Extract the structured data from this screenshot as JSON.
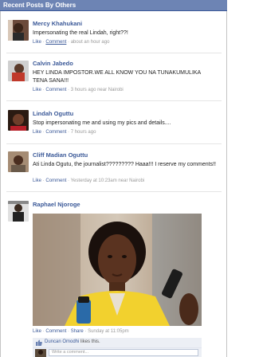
{
  "panel": {
    "title": "Recent Posts By Others"
  },
  "posts": [
    {
      "name": "Mercy Khahukani",
      "text": "Impersonating the real Lindah, right??!",
      "meta_like": "Like",
      "meta_comment": "Comment",
      "meta_time": "about an hour ago"
    },
    {
      "name": "Calvin Jabedo",
      "text": "HEY LINDA IMPOSTOR.WE ALL KNOW YOU NA TUNAKUMULIKA TENA SANA!!!",
      "meta_like": "Like",
      "meta_comment": "Comment",
      "meta_time": "3 hours ago near Nairobi"
    },
    {
      "name": "Lindah Oguttu",
      "text": "Stop impersonating me and using my pics and details....",
      "meta_like": "Like",
      "meta_comment": "Comment",
      "meta_time": "7 hours ago"
    },
    {
      "name": "Cliff Madian Oguttu",
      "text": "Ati Linda Ogutu, the journalist????????? Haaa!!! I reserve my comments!!",
      "meta_like": "Like",
      "meta_comment": "Comment",
      "meta_time": "Yesterday at 10:23am near Nairobi"
    },
    {
      "name": "Raphael Njoroge",
      "text": "",
      "meta_like": "Like",
      "meta_comment": "Comment",
      "meta_share": "Share",
      "meta_time": "Sunday at 11:05pm"
    }
  ],
  "likes": {
    "liker": "Duncan Omodhi",
    "suffix": "likes this."
  },
  "comment_box": {
    "placeholder": "Write a comment..."
  }
}
